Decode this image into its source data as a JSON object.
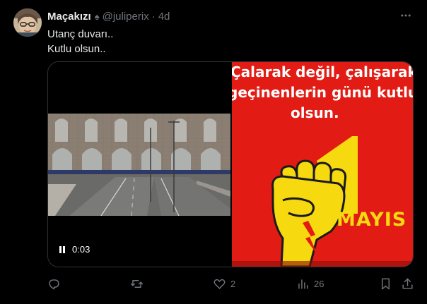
{
  "user": {
    "display_name": "Maçakızı",
    "badge_icon": "spade-icon",
    "handle": "@juliperix",
    "separator": "·",
    "time": "4d"
  },
  "tweet": {
    "lines": [
      "Utanç duvarı..",
      "Kutlu olsun.."
    ]
  },
  "media": {
    "video": {
      "duration": "0:03",
      "state": "paused"
    },
    "poster": {
      "line1": "Çalarak değil, çalışarak",
      "line2": "geçinenlerin günü kutlu",
      "line3": "olsun.",
      "big_number": "1",
      "mayis": "MAYIS",
      "background_color": "#e21c14",
      "accent_color": "#f6d90e"
    }
  },
  "actions": {
    "reply": {
      "icon": "reply-icon",
      "count": ""
    },
    "retweet": {
      "icon": "retweet-icon",
      "count": ""
    },
    "like": {
      "icon": "heart-icon",
      "count": "2"
    },
    "views": {
      "icon": "views-icon",
      "count": "26"
    },
    "bookmark": {
      "icon": "bookmark-icon"
    },
    "share": {
      "icon": "share-icon"
    }
  },
  "colors": {
    "background": "#000000",
    "text": "#e7e9ea",
    "secondary": "#71767b",
    "border": "#2f3336"
  }
}
